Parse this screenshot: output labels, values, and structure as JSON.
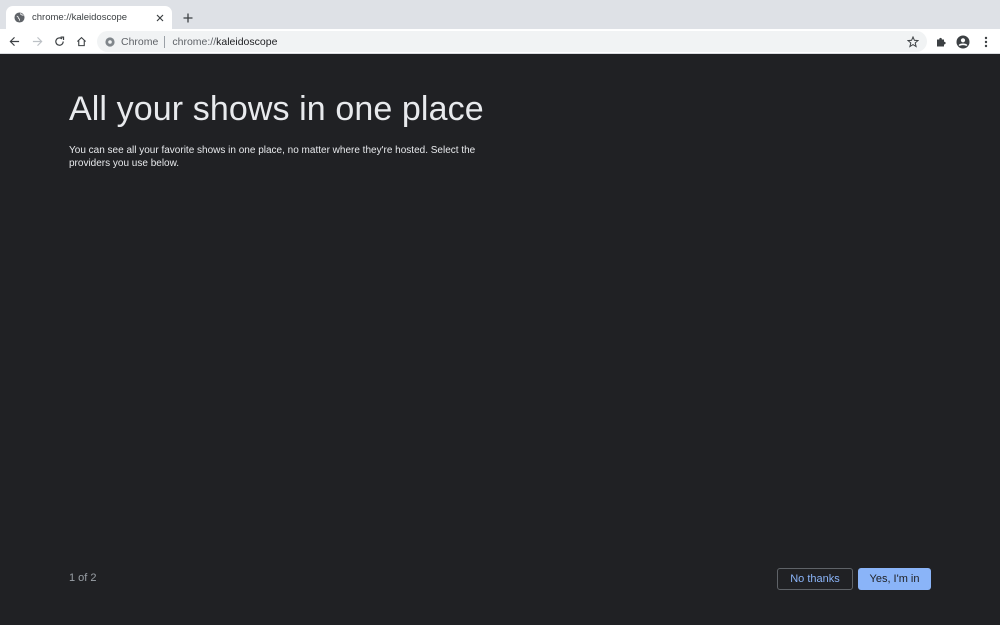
{
  "tab": {
    "title": "chrome://kaleidoscope",
    "favicon": "globe-icon",
    "close_icon": "close-icon"
  },
  "new_tab_icon": "plus-icon",
  "toolbar": {
    "back_icon": "back-arrow-icon",
    "forward_icon": "forward-arrow-icon",
    "reload_icon": "reload-icon",
    "home_icon": "home-icon",
    "bookmark_icon": "star-icon",
    "extensions_icon": "puzzle-icon",
    "profile_icon": "account-icon",
    "menu_icon": "kebab-menu-icon"
  },
  "omnibox": {
    "chip_label": "Chrome",
    "url_scheme": "chrome://",
    "url_host": "kaleidoscope"
  },
  "page": {
    "headline": "All your shows in one place",
    "subtext": "You can see all your favorite shows in one place, no matter where they're hosted. Select the providers you use below.",
    "pager": "1 of 2",
    "secondary_button": "No thanks",
    "primary_button": "Yes, I'm in"
  },
  "colors": {
    "background": "#202124",
    "accent": "#8ab4f8",
    "text": "#e8eaed"
  }
}
